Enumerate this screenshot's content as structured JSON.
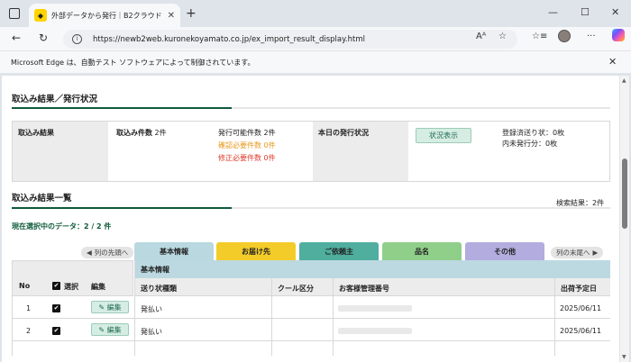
{
  "browser": {
    "tab_title": "外部データから発行｜B2クラウド",
    "url": "https://newb2web.kuronekoyamato.co.jp/ex_import_result_display.html",
    "infobar_message": "Microsoft Edge は、自動テスト ソフトウェアによって制御されています。"
  },
  "import_section": {
    "title": "取込み結果／発行状況",
    "result_label": "取込み結果",
    "count_label": "取込み件数",
    "count_value": "2件",
    "issuable": "発行可能件数 2件",
    "confirm_needed": "確認必要件数 0件",
    "fix_needed": "修正必要件数 0件",
    "today_label": "本日の発行状況",
    "status_button": "状況表示",
    "registered": "登録済送り状：0枚",
    "internal": "内未発行分：0枚"
  },
  "list_section": {
    "title": "取込み結果一覧",
    "search_result": "検索結果：2件",
    "selected": "現在選択中のデータ：2 / 2 件",
    "prev_nav": "列の先頭へ",
    "next_nav": "列の末尾へ",
    "tabs": [
      {
        "label": "基本情報",
        "color": "#b9d8e0"
      },
      {
        "label": "お届け先",
        "color": "#f3cc2a"
      },
      {
        "label": "ご依頼主",
        "color": "#4fae9e"
      },
      {
        "label": "品名",
        "color": "#8fcf8a"
      },
      {
        "label": "その他",
        "color": "#b3acdf"
      }
    ],
    "group_header": "基本情報",
    "headers": {
      "no": "No",
      "select": "選択",
      "edit": "編集",
      "invoice_type": "送り状種類",
      "cool": "クール区分",
      "customer_no": "お客様管理番号",
      "ship_date": "出荷予定日"
    },
    "rows": [
      {
        "no": "1",
        "edit": "編集",
        "invoice_type": "発払い",
        "ship_date": "2025/06/11"
      },
      {
        "no": "2",
        "edit": "編集",
        "invoice_type": "発払い",
        "ship_date": "2025/06/11"
      }
    ]
  }
}
